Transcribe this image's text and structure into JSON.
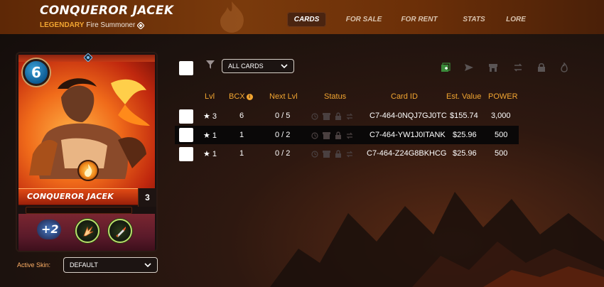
{
  "header": {
    "title": "CONQUEROR JACEK",
    "rarity": "LEGENDARY",
    "subtitle_rest": "Fire Summoner",
    "tabs": [
      {
        "label": "CARDS",
        "active": true
      },
      {
        "label": "FOR SALE",
        "active": false
      },
      {
        "label": "FOR RENT",
        "active": false
      },
      {
        "label": "STATS",
        "active": false
      },
      {
        "label": "LORE",
        "active": false
      }
    ]
  },
  "card": {
    "mana": "6",
    "name": "CONQUEROR JACEK",
    "level": "3",
    "buff": "+2",
    "abilities": [
      "claw-icon",
      "dagger-icon"
    ]
  },
  "skin": {
    "label": "Active Skin:",
    "value": "DEFAULT"
  },
  "toolbar": {
    "filter_value": "ALL CARDS",
    "icons": [
      "add-icon",
      "send-icon",
      "market-icon",
      "transfer-icon",
      "lock-icon",
      "burn-icon"
    ]
  },
  "table": {
    "headers": [
      "Lvl",
      "BCX",
      "Next Lvl",
      "Status",
      "Card ID",
      "Est. Value",
      "POWER"
    ],
    "rows": [
      {
        "lvl": "3",
        "bcx": "6",
        "next": "0 / 5",
        "card_id": "C7-464-0NQJ7GJ0TC",
        "value": "$155.74",
        "power": "3,000"
      },
      {
        "lvl": "1",
        "bcx": "1",
        "next": "0 / 2",
        "card_id": "C7-464-YW1J0ITANK",
        "value": "$25.96",
        "power": "500"
      },
      {
        "lvl": "1",
        "bcx": "1",
        "next": "0 / 2",
        "card_id": "C7-464-Z24G8BKHCG",
        "value": "$25.96",
        "power": "500"
      }
    ]
  },
  "colors": {
    "accent": "#f2a531",
    "header_bg": "#7a3a0c",
    "mana_blue": "#0e5b92"
  }
}
